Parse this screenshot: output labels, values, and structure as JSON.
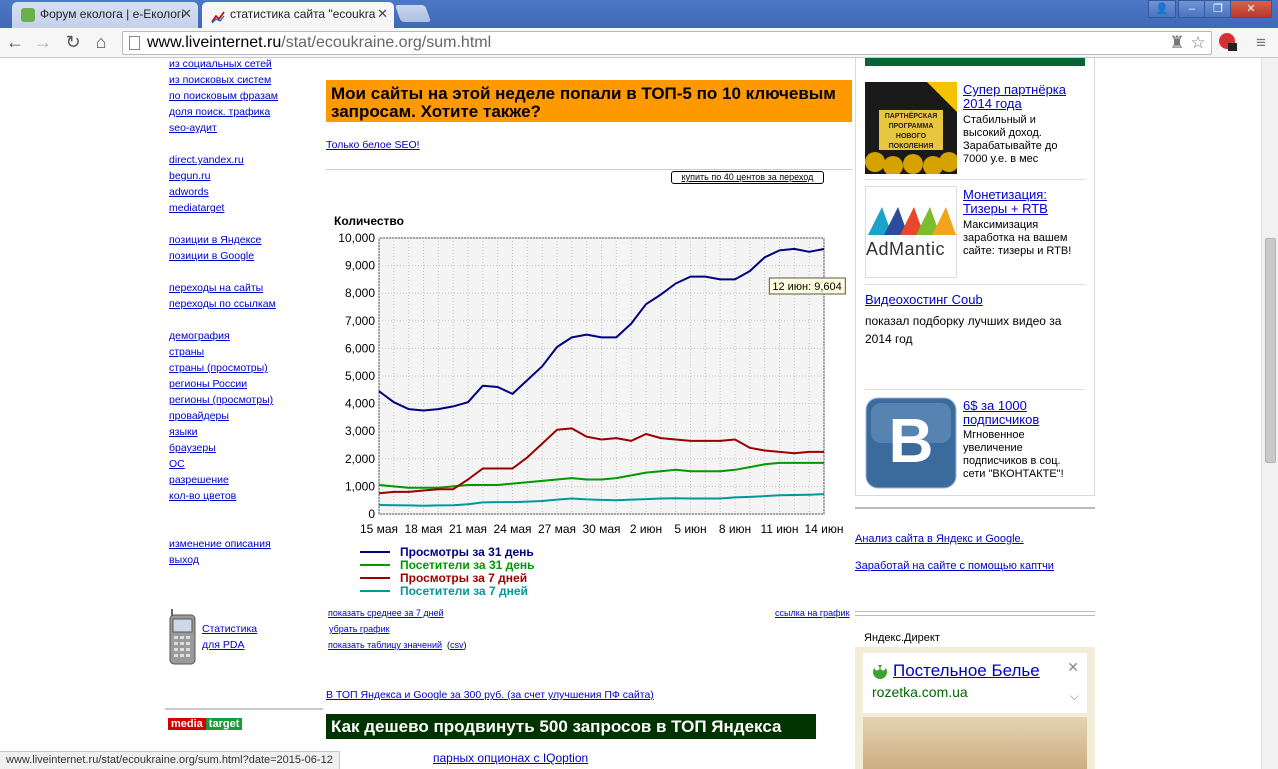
{
  "browser": {
    "tabs": [
      {
        "title": "Форум еколога | е-Екологі",
        "active": false
      },
      {
        "title": "статистика сайта \"ecoukra",
        "active": true
      }
    ],
    "url_host": "www.liveinternet.ru",
    "url_path": "/stat/ecoukraine.org/sum.html",
    "status_url": "www.liveinternet.ru/stat/ecoukraine.org/sum.html?date=2015-06-12"
  },
  "left_nav": {
    "groups": [
      [
        "из социальных сетей",
        "из поисковых систем",
        "по поисковым фразам",
        "доля поиск. трафика",
        "seo-аудит"
      ],
      [
        "direct.yandex.ru",
        "begun.ru",
        "adwords",
        "mediatarget"
      ],
      [
        "позиции в Яндексе",
        "позиции в Google"
      ],
      [
        "переходы на сайты",
        "переходы по ссылкам"
      ],
      [
        "демография",
        "страны",
        "страны (просмотры)",
        "регионы России",
        "регионы (просмотры)",
        "провайдеры",
        "языки",
        "браузеры",
        "ОС",
        "разрешение",
        "кол-во цветов"
      ],
      [
        "изменение описания",
        "выход"
      ]
    ],
    "pda_line1": "Статистика",
    "pda_line2": "для PDA",
    "mt_logo_1": "media",
    "mt_logo_2": "target"
  },
  "center": {
    "banner_top": "Мои сайты на этой неделе попали в ТОП-5 по 10 ключевым запросам. Хотите также?",
    "link_white_seo": "Только белое SEO!",
    "buy_button": "купить по 40 центов за переход",
    "chart_links": {
      "avg7": "показать среднее за 7 дней",
      "remove": "убрать график",
      "table": "показать таблицу значений",
      "csv": "csv",
      "link_to_chart": "ссылка на график"
    },
    "link_top_yandex": "В ТОП Яндекса и Google за 300 руб. (за счет улучшения ПФ сайта)",
    "banner_bottom": "Как дешево продвинуть 500 запросов в ТОП Яндекса",
    "link_iqoption": "парных опционах с IQoption"
  },
  "chart_data": {
    "type": "line",
    "ylabel": "Количество",
    "ylim": [
      0,
      10000
    ],
    "yticks": [
      "0",
      "1,000",
      "2,000",
      "3,000",
      "4,000",
      "5,000",
      "6,000",
      "7,000",
      "8,000",
      "9,000",
      "10,000"
    ],
    "x": [
      "15 мая",
      "16 мая",
      "17 мая",
      "18 мая",
      "19 мая",
      "20 мая",
      "21 мая",
      "22 мая",
      "23 мая",
      "24 мая",
      "25 мая",
      "26 мая",
      "27 мая",
      "28 мая",
      "29 мая",
      "30 мая",
      "31 мая",
      "1 июн",
      "2 июн",
      "3 июн",
      "4 июн",
      "5 июн",
      "6 июн",
      "7 июн",
      "8 июн",
      "9 июн",
      "10 июн",
      "11 июн",
      "12 июн",
      "13 июн",
      "14 июн"
    ],
    "xticks": [
      "15 мая",
      "18 мая",
      "21 мая",
      "24 мая",
      "27 мая",
      "30 мая",
      "2 июн",
      "5 июн",
      "8 июн",
      "11 июн",
      "14 июн"
    ],
    "grid": true,
    "legend_position": "bottom",
    "tooltip": "12 июн: 9,604",
    "series": [
      {
        "name": "Просмотры за 31 день",
        "color": "#000080",
        "values": [
          4450,
          4050,
          3800,
          3750,
          3800,
          3900,
          4050,
          4650,
          4600,
          4350,
          4850,
          5350,
          6050,
          6400,
          6500,
          6400,
          6400,
          6900,
          7600,
          7950,
          8350,
          8600,
          8600,
          8500,
          8500,
          8800,
          9300,
          9550,
          9604,
          9500,
          9600
        ]
      },
      {
        "name": "Посетители за 31 день",
        "color": "#009900",
        "values": [
          1050,
          1000,
          950,
          950,
          950,
          1000,
          1050,
          1050,
          1050,
          1100,
          1150,
          1200,
          1250,
          1300,
          1250,
          1250,
          1300,
          1400,
          1500,
          1550,
          1600,
          1550,
          1550,
          1550,
          1600,
          1700,
          1800,
          1850,
          1850,
          1850,
          1850
        ]
      },
      {
        "name": "Просмотры за 7 дней",
        "color": "#990000",
        "values": [
          750,
          800,
          800,
          850,
          900,
          900,
          1250,
          1650,
          1650,
          1650,
          2050,
          2550,
          3050,
          3100,
          2800,
          2700,
          2750,
          2650,
          2900,
          2750,
          2700,
          2650,
          2650,
          2650,
          2700,
          2400,
          2300,
          2250,
          2200,
          2250,
          2250
        ]
      },
      {
        "name": "Посетители за 7 дней",
        "color": "#009999",
        "values": [
          330,
          320,
          310,
          300,
          310,
          320,
          350,
          420,
          430,
          430,
          450,
          470,
          520,
          560,
          530,
          510,
          500,
          520,
          540,
          560,
          570,
          560,
          560,
          560,
          600,
          620,
          650,
          680,
          690,
          700,
          720
        ]
      }
    ]
  },
  "right": {
    "ads": [
      {
        "title": "Супер партнёрка 2014 года",
        "text": "Стабильный и высокий доход. Зарабатывайте до 7000 у.е. в мес",
        "img_text": "ПАРТНЁРСКАЯ ПРОГРАММА НОВОГО ПОКОЛЕНИЯ"
      },
      {
        "title": "Монетизация: Тизеры + RTB",
        "text": "Максимизация заработка на вашем сайте: тизеры и RTB!",
        "img_text": "AdMantic"
      },
      {
        "title": "Видеохостинг Coub",
        "text": "показал подборку лучших видео за 2014 год"
      },
      {
        "title": "6$ за 1000 подписчиков",
        "text": "Мгновенное увеличение подписчиков в соц. сети \"ВКОНТАКТЕ\"!",
        "img_text": "B"
      }
    ],
    "link_analysis": "Анализ сайта в Яндекс и Google.",
    "link_captcha": "Заработай на сайте с помощью каптчи",
    "ydirect_label": "Яндекс.Директ",
    "ydirect_ad_title": "Постельное Белье",
    "ydirect_ad_domain": "rozetka.com.ua"
  }
}
